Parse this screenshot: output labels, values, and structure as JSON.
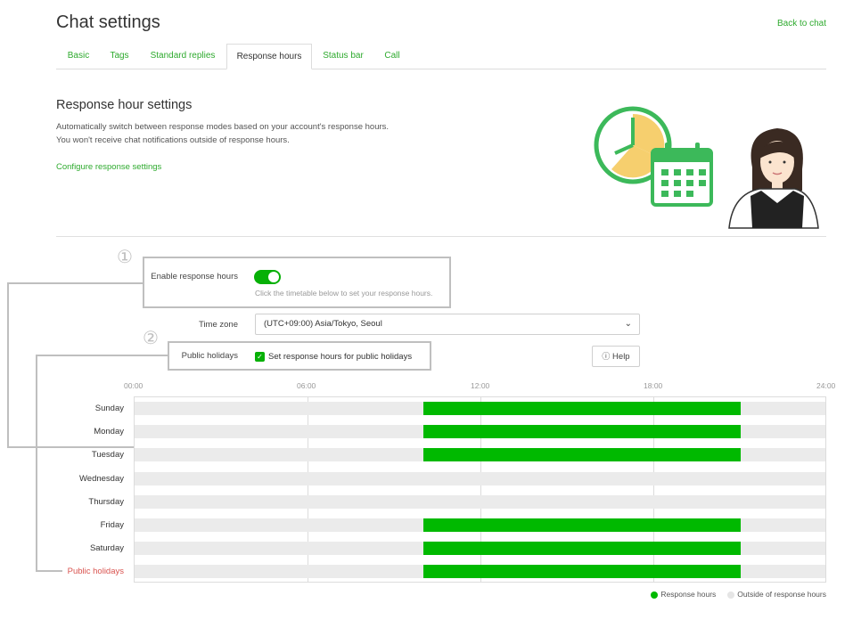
{
  "header": {
    "title": "Chat settings",
    "back_link": "Back to chat"
  },
  "tabs": [
    {
      "label": "Basic"
    },
    {
      "label": "Tags"
    },
    {
      "label": "Standard replies"
    },
    {
      "label": "Response hours",
      "active": true
    },
    {
      "label": "Status bar"
    },
    {
      "label": "Call"
    }
  ],
  "section": {
    "title": "Response hour settings",
    "desc_line1": "Automatically switch between response modes based on your account's response hours.",
    "desc_line2": "You won't receive chat notifications outside of response hours.",
    "config_link": "Configure response settings"
  },
  "callouts": {
    "one": "①",
    "two": "②"
  },
  "enable": {
    "label": "Enable response hours",
    "on": true,
    "hint": "Click the timetable below to set your response hours."
  },
  "timezone": {
    "label": "Time zone",
    "value": "(UTC+09:00) Asia/Tokyo, Seoul"
  },
  "holidays": {
    "label": "Public holidays",
    "checkbox_label": "Set response hours for public holidays",
    "checked": true
  },
  "help_label": "Help",
  "timetable": {
    "hour_labels": [
      "00:00",
      "06:00",
      "12:00",
      "18:00",
      "24:00"
    ],
    "rows": [
      {
        "label": "Sunday",
        "start": 10,
        "end": 21
      },
      {
        "label": "Monday",
        "start": 10,
        "end": 21
      },
      {
        "label": "Tuesday",
        "start": 10,
        "end": 21
      },
      {
        "label": "Wednesday",
        "start": null,
        "end": null
      },
      {
        "label": "Thursday",
        "start": null,
        "end": null
      },
      {
        "label": "Friday",
        "start": 10,
        "end": 21
      },
      {
        "label": "Saturday",
        "start": 10,
        "end": 21
      },
      {
        "label": "Public holidays",
        "start": 10,
        "end": 21,
        "holiday": true
      }
    ]
  },
  "legend": {
    "on": "Response hours",
    "off": "Outside of response hours"
  },
  "colors": {
    "accent": "#06b006",
    "bar": "#00b900",
    "link": "#2eaa2e",
    "holiday": "#d9534f",
    "track": "#ebebeb"
  },
  "icons": [
    "clock-icon",
    "calendar-icon",
    "check-icon",
    "info-icon",
    "chevron-down-icon"
  ]
}
